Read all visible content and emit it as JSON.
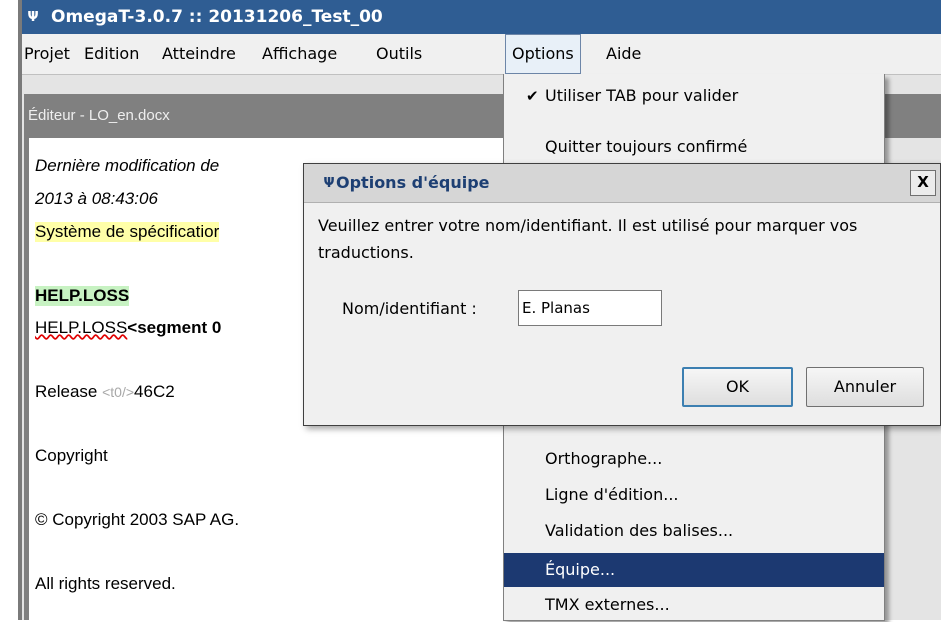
{
  "window": {
    "title": "OmegaT-3.0.7 :: 20131206_Test_00"
  },
  "menubar": {
    "items": [
      "Projet",
      "Edition",
      "Atteindre",
      "Affichage",
      "Outils",
      "Options",
      "Aide"
    ],
    "active": "Options"
  },
  "editor": {
    "header": "Éditeur - LO_en.docx",
    "lines": {
      "last_modified": "Dernière modification de",
      "date": "2013 à 08:43:06",
      "spec": "Système de spécificatior",
      "help_loss": "HELP.LOSS",
      "help_loss_src": "HELP.LOSS",
      "segment_tag": "<segment 0",
      "release": "Release",
      "release_tag": "<t0/>",
      "release_value": "46C2",
      "copyright": "Copyright",
      "copyright_notice": "© Copyright 2003 SAP AG.",
      "rights": "All rights reserved."
    }
  },
  "options_menu": {
    "items": [
      {
        "label": "Utiliser TAB pour valider",
        "checked": true
      },
      {
        "label": "Quitter toujours confirmé",
        "checked": false
      },
      {
        "label": "Orthographe...",
        "checked": false
      },
      {
        "label": "Ligne d'édition...",
        "checked": false
      },
      {
        "label": "Validation des balises...",
        "checked": false
      },
      {
        "label": "Équipe...",
        "checked": false,
        "selected": true
      },
      {
        "label": "TMX externes...",
        "checked": false
      }
    ]
  },
  "dialog": {
    "title": "Options d'équipe",
    "close_label": "X",
    "message": "Veuillez entrer votre nom/identifiant. Il est utilisé pour marquer vos traductions.",
    "field_label": "Nom/identifiant :",
    "field_value": "E. Planas",
    "ok_label": "OK",
    "cancel_label": "Annuler"
  },
  "colors": {
    "titlebar": "#2f5d93",
    "menu_selected": "#1c3971",
    "highlight_yellow": "#ffffa8",
    "highlight_green": "#c7f2c2"
  }
}
